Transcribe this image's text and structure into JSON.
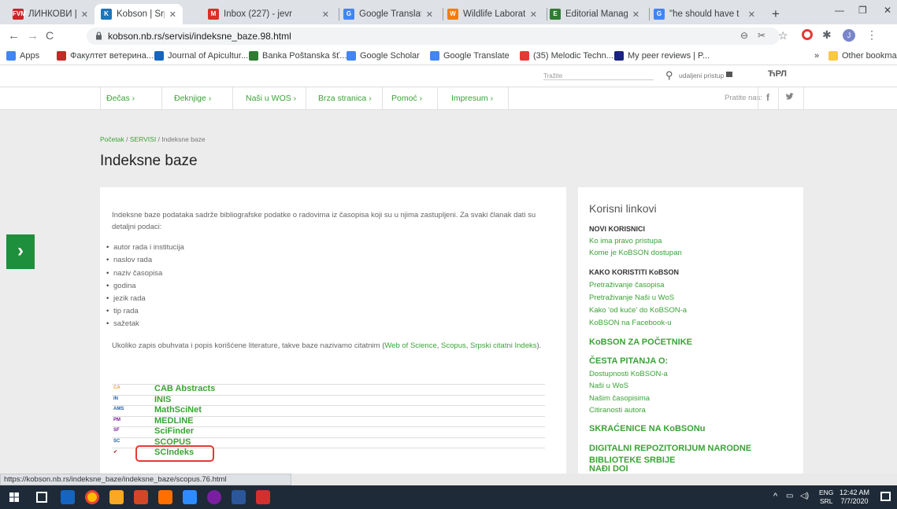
{
  "browser": {
    "tabs": [
      {
        "label": "ЛИНКОВИ | ФВМ",
        "fav_text": "FVM",
        "color": "#c62828"
      },
      {
        "label": "Kobson | Srpski | I",
        "fav_text": "K",
        "color": "#1b75bb",
        "active": true
      },
      {
        "label": "Inbox (227) - jevr",
        "fav_text": "M",
        "color": "#d93025"
      },
      {
        "label": "Google Translate",
        "fav_text": "G",
        "color": "#4285f4"
      },
      {
        "label": "Wildlife Laborator",
        "fav_text": "W",
        "color": "#f57c00"
      },
      {
        "label": "Editorial Manager",
        "fav_text": "E",
        "color": "#2e7d32"
      },
      {
        "label": "\"he should have t",
        "fav_text": "G",
        "color": "#4285f4"
      }
    ],
    "new_tab": "+",
    "window_controls": {
      "minimize": "—",
      "maximize": "❐",
      "close": "✕"
    },
    "url": "kobson.nb.rs/servisi/indeksne_baze.98.html",
    "bookmarks": [
      {
        "label": "Apps",
        "color": "#4285f4"
      },
      {
        "label": "Факултет ветерина...",
        "color": "#c62828"
      },
      {
        "label": "Journal of Apicultur...",
        "color": "#1565c0"
      },
      {
        "label": "Banka Poštanska šť...",
        "color": "#2e7d32"
      },
      {
        "label": "Google Scholar",
        "color": "#4285f4"
      },
      {
        "label": "Google Translate",
        "color": "#4285f4"
      },
      {
        "label": "(35) Melodic Techn...",
        "color": "#e53935"
      },
      {
        "label": "My peer reviews | P...",
        "color": "#1a237e"
      }
    ],
    "bookmarks_overflow": "»",
    "other_bookmarks": "Other bookmarks"
  },
  "site": {
    "search_placeholder": "Tražite",
    "remote_access": "udaljeni pristup",
    "lang": "ЋРЛ",
    "nav": [
      {
        "label": "Đečas ›"
      },
      {
        "label": "Đeknjige ›"
      },
      {
        "label": "Naši u WOS ›"
      },
      {
        "label": "Brza stranica ›"
      },
      {
        "label": "Pomoć ›"
      },
      {
        "label": "Impresum ›"
      }
    ],
    "follow_label": "Pratite nas:",
    "breadcrumb": {
      "home": "Početak",
      "sep1": " / ",
      "section": "SERVISI",
      "sep2": " / ",
      "current": "Indeksne baze"
    },
    "page_title": "Indeksne baze",
    "intro": "Indeksne baze podataka sadrže bibliografske podatke o radovima iz časopisa koji su u njima zastupljeni. Za svaki članak dati su detaljni podaci:",
    "bullets": [
      "autor rada i institucija",
      "naslov rada",
      "naziv časopisa",
      "godina",
      "jezik rada",
      "tip rada",
      "sažetak"
    ],
    "citation_text_before": "Ukoliko zapis obuhvata i popis korišćene literature, takve baze nazivamo citatnim (",
    "citation_links": [
      "Web of Science",
      "Scopus",
      "Srpski citatni Indeks"
    ],
    "citation_sep": ", ",
    "citation_text_after": ").",
    "databases": [
      {
        "abbr": "CA",
        "name": "CAB Abstracts",
        "color": "#f0a030"
      },
      {
        "abbr": "IN",
        "name": "INIS",
        "color": "#1f5fa8"
      },
      {
        "abbr": "AMS",
        "name": "MathSciNet",
        "color": "#1f5fa8"
      },
      {
        "abbr": "PM",
        "name": "MEDLINE",
        "color": "#7b1fa2"
      },
      {
        "abbr": "SF",
        "name": "SciFinder",
        "color": "#7b1fa2"
      },
      {
        "abbr": "SC",
        "name": "SCOPUS",
        "color": "#1f5fa8"
      },
      {
        "abbr": "✔",
        "name": "SCIndeks",
        "color": "#b71c1c"
      }
    ],
    "sidebar": {
      "title": "Korisni linkovi",
      "novi_head": "NOVI KORISNICI",
      "novi_links": [
        "Ko ima pravo pristupa",
        "Kome je KoBSON dostupan"
      ],
      "kako_head": "KAKO KORISTITI KoBSON",
      "kako_links": [
        "Pretraživanje časopisa",
        "Pretraživanje Naši u WoS",
        "Kako 'od kuće' do KoBSON-a",
        "KoBSON na Facebook-u"
      ],
      "pocetnike": "KoBSON ZA POČETNIKE",
      "cesta_head": "ČESTA PITANJA O:",
      "cesta_links": [
        "Dostupnosti KoBSON-a",
        "Naši u WoS",
        "Našim časopisima",
        "Citiranosti autora"
      ],
      "skracenice": "SKRAĆENICE NA KoBSONu",
      "repozitorijum_1": "DIGITALNI REPOZITORIJUM NARODNE",
      "repozitorijum_2": "BIBLIOTEKE SRBIJE",
      "nadji_doi": "NAĐI DOI"
    }
  },
  "status_url": "https://kobson.nb.rs/indeksne_baze/indeksne_baze/scopus.76.html",
  "taskbar": {
    "lang_top": "ENG",
    "lang_bottom": "SRL",
    "time": "12:42 AM",
    "date": "7/7/2020"
  }
}
